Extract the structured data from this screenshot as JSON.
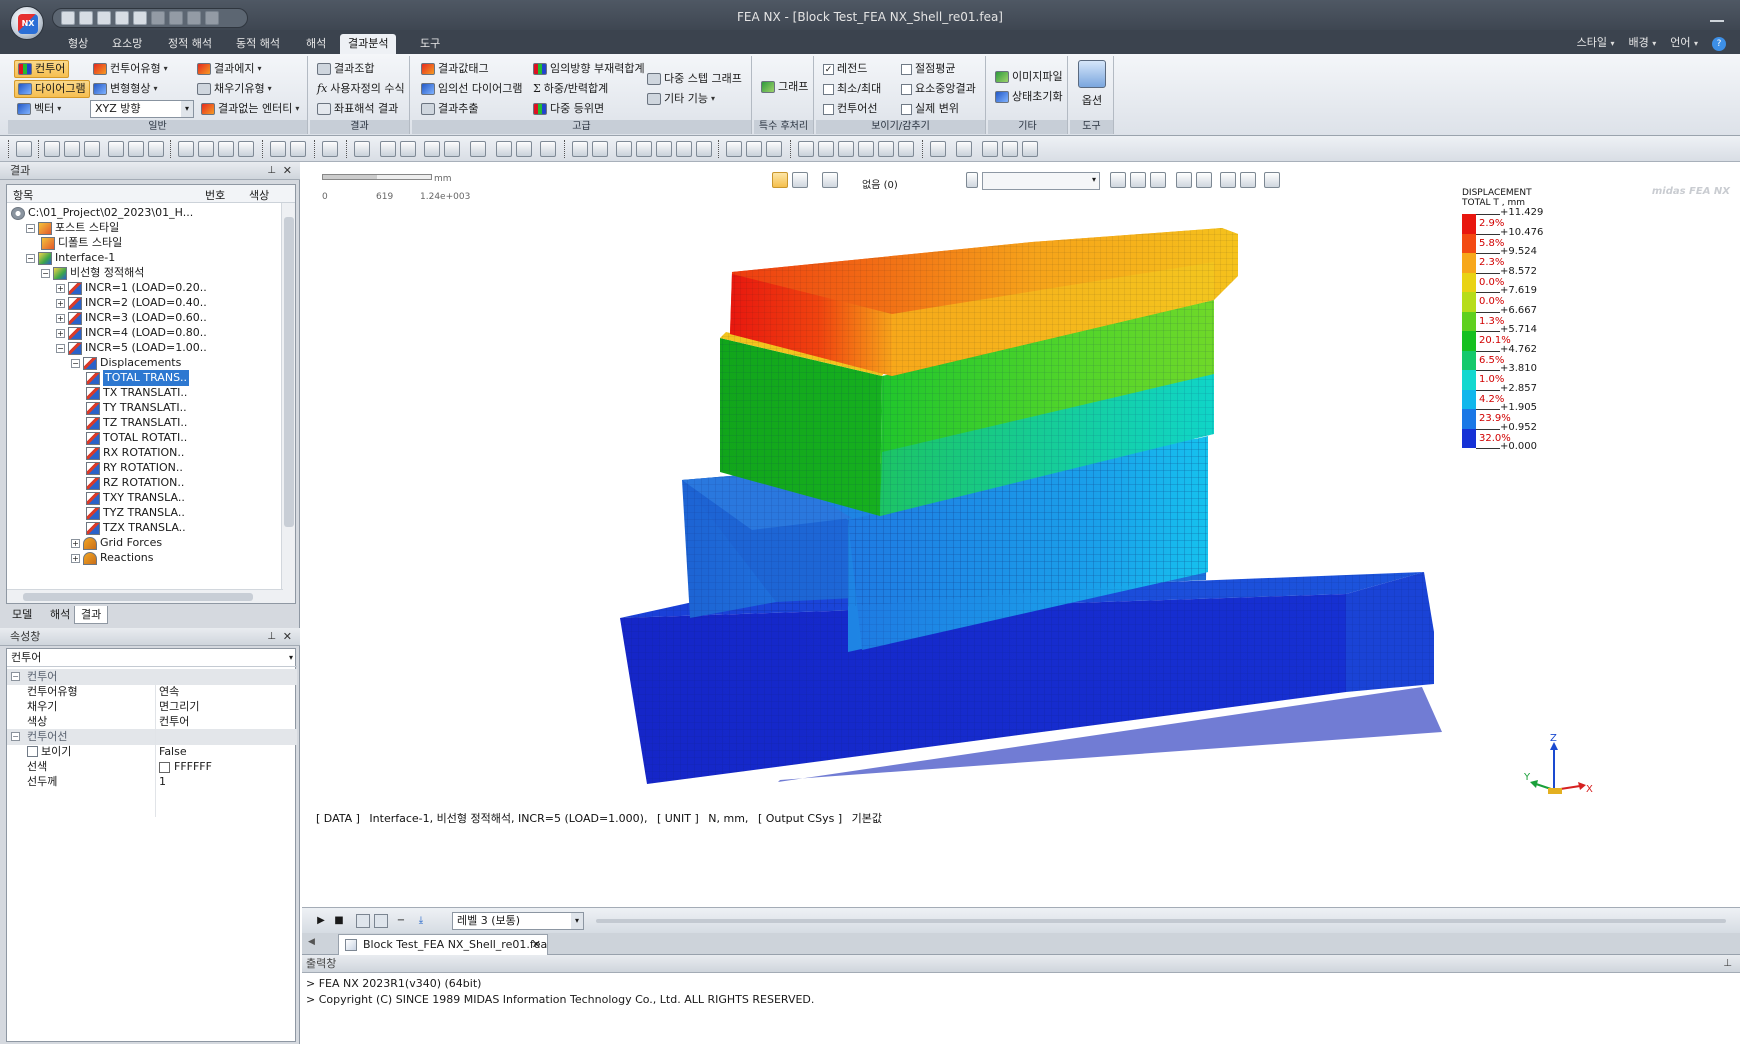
{
  "window": {
    "title": "FEA NX - [Block Test_FEA NX_Shell_re01.fea]",
    "logo_text": "NX"
  },
  "ribbon_tabs": [
    "형상",
    "요소망",
    "정적 해석",
    "동적 해석",
    "해석",
    "결과분석",
    "도구"
  ],
  "active_tab": "결과분석",
  "ribbon_right": {
    "style": "스타일",
    "background": "배경",
    "language": "언어",
    "help": "?"
  },
  "ribbon": {
    "general": {
      "label": "일반",
      "contour": "컨투어",
      "contour_type": "컨투어유형",
      "result_edge": "결과에지",
      "diagram": "다이어그램",
      "deformed": "변형형상",
      "fill_type": "채우기유형",
      "vector": "벡터",
      "xyz_direction": "XYZ 방향",
      "no_result_entity": "결과없는 엔터티"
    },
    "result": {
      "label": "결과",
      "combination": "결과조합",
      "user_formula": "사용자정의 수식",
      "coord_result": "좌표해석 결과"
    },
    "advanced": {
      "label": "고급",
      "result_tag": "결과값태그",
      "arbitrary_line_diagram": "임의선 다이어그램",
      "result_extract": "결과추출",
      "arbitrary_member_force": "임의방향 부재력합계",
      "load_reaction_sum": "하중/반력합계",
      "multi_iso_surface": "다중 등위면",
      "multi_step_graph": "다중 스텝 그래프",
      "other_functions": "기타 기능"
    },
    "special_post": {
      "label": "특수 후처리",
      "graph": "그래프"
    },
    "show_hide": {
      "label": "보이기/감추기",
      "legend": "레전드",
      "min_max": "최소/최대",
      "contour_line": "컨투어선",
      "node_average": "절점평균",
      "element_result": "요소중앙결과",
      "real_displacement": "실제 변위"
    },
    "etc": {
      "label": "기타",
      "image_file": "이미지파일",
      "state_reset": "상태초기화"
    },
    "tools": {
      "label": "도구",
      "options": "옵션"
    }
  },
  "left_panel": {
    "result_title": "결과",
    "headers": {
      "item": "항목",
      "number": "번호",
      "color": "색상"
    },
    "tree": [
      {
        "label": "C:\\01_Project\\02_2023\\01_H...",
        "level": 0,
        "icon": "path-icon",
        "toggle": ""
      },
      {
        "label": "포스트 스타일",
        "level": 1,
        "icon": "post-style-icon",
        "toggle": "−"
      },
      {
        "label": "디폴트 스타일",
        "level": 2,
        "icon": "post-style-icon",
        "toggle": ""
      },
      {
        "label": "Interface-1",
        "level": 1,
        "icon": "analysis-case-icon",
        "toggle": "−"
      },
      {
        "label": "비선형 정적해석",
        "level": 2,
        "icon": "analysis-case-icon",
        "toggle": "−"
      },
      {
        "label": "INCR=1 (LOAD=0.20..",
        "level": 3,
        "icon": "result-chart-icon",
        "toggle": "+"
      },
      {
        "label": "INCR=2 (LOAD=0.40..",
        "level": 3,
        "icon": "result-chart-icon",
        "toggle": "+"
      },
      {
        "label": "INCR=3 (LOAD=0.60..",
        "level": 3,
        "icon": "result-chart-icon",
        "toggle": "+"
      },
      {
        "label": "INCR=4 (LOAD=0.80..",
        "level": 3,
        "icon": "result-chart-icon",
        "toggle": "+"
      },
      {
        "label": "INCR=5 (LOAD=1.00..",
        "level": 3,
        "icon": "result-chart-icon",
        "toggle": "−"
      },
      {
        "label": "Displacements",
        "level": 4,
        "icon": "result-group-icon",
        "toggle": "−"
      },
      {
        "label": "TOTAL TRANS..",
        "level": 5,
        "icon": "result-chart-icon",
        "toggle": "",
        "selected": true
      },
      {
        "label": "TX TRANSLATI..",
        "level": 5,
        "icon": "result-chart-icon",
        "toggle": ""
      },
      {
        "label": "TY TRANSLATI..",
        "level": 5,
        "icon": "result-chart-icon",
        "toggle": ""
      },
      {
        "label": "TZ TRANSLATI..",
        "level": 5,
        "icon": "result-chart-icon",
        "toggle": ""
      },
      {
        "label": "TOTAL ROTATI..",
        "level": 5,
        "icon": "result-chart-icon",
        "toggle": ""
      },
      {
        "label": "RX ROTATION..",
        "level": 5,
        "icon": "result-chart-icon",
        "toggle": ""
      },
      {
        "label": "RY ROTATION..",
        "level": 5,
        "icon": "result-chart-icon",
        "toggle": ""
      },
      {
        "label": "RZ ROTATION..",
        "level": 5,
        "icon": "result-chart-icon",
        "toggle": ""
      },
      {
        "label": "TXY TRANSLA..",
        "level": 5,
        "icon": "result-chart-icon",
        "toggle": ""
      },
      {
        "label": "TYZ TRANSLA..",
        "level": 5,
        "icon": "result-chart-icon",
        "toggle": ""
      },
      {
        "label": "TZX TRANSLA..",
        "level": 5,
        "icon": "result-chart-icon",
        "toggle": ""
      },
      {
        "label": "Grid Forces",
        "level": 4,
        "icon": "force-group-icon",
        "toggle": "+"
      },
      {
        "label": "Reactions",
        "level": 4,
        "icon": "force-group-icon",
        "toggle": "+"
      }
    ],
    "tabs": [
      "모델",
      "해석",
      "결과"
    ],
    "active_panel_tab": "결과",
    "properties_title": "속성창",
    "properties_combo": "컨투어",
    "properties": [
      {
        "kind": "cat",
        "key": "컨투어"
      },
      {
        "kind": "row",
        "key": "컨투어유형",
        "value": "연속"
      },
      {
        "kind": "row",
        "key": "채우기",
        "value": "면그리기"
      },
      {
        "kind": "row",
        "key": "색상",
        "value": "컨투어"
      },
      {
        "kind": "cat",
        "key": "컨투어선"
      },
      {
        "kind": "row",
        "key": "보이기",
        "value": "False",
        "checkbox": true
      },
      {
        "kind": "row",
        "key": "선색",
        "value": "FFFFFF",
        "swatch": "#FFFFFF"
      },
      {
        "kind": "row",
        "key": "선두께",
        "value": "1"
      }
    ]
  },
  "viewport": {
    "scale": {
      "unit": "mm",
      "t0": "0",
      "t1": "619",
      "t2": "1.24e+003"
    },
    "view_select": "없음 (0)",
    "brand": "midas FEA NX",
    "legend": {
      "title": "DISPLACEMENT",
      "subtitle": "TOTAL T , mm",
      "values": [
        "+11.429",
        "+10.476",
        "+9.524",
        "+8.572",
        "+7.619",
        "+6.667",
        "+5.714",
        "+4.762",
        "+3.810",
        "+2.857",
        "+1.905",
        "+0.952",
        "+0.000"
      ],
      "percents": [
        "2.9%",
        "5.8%",
        "2.3%",
        "0.0%",
        "0.0%",
        "1.3%",
        "20.1%",
        "6.5%",
        "1.0%",
        "4.2%",
        "23.9%",
        "32.0%"
      ],
      "colors": [
        "#e8170f",
        "#f34a12",
        "#f7a71a",
        "#e9d313",
        "#b6dd1a",
        "#5fd01f",
        "#15c020",
        "#14c96c",
        "#12d8cf",
        "#11b7ec",
        "#1a78e6",
        "#1632d6"
      ]
    },
    "axis": {
      "x": "X",
      "y": "Y",
      "z": "Z"
    },
    "status": {
      "data_tag": "[ DATA ]",
      "data_value": "Interface-1, 비선형 정적해석, INCR=5 (LOAD=1.000),",
      "unit_tag": "[ UNIT ]",
      "unit_value": "N, mm,",
      "csys_tag": "[ Output CSys ]",
      "csys_value": "기본값"
    }
  },
  "animation": {
    "level": "레벨 3 (보통)"
  },
  "document_tab": "Block Test_FEA NX_Shell_re01.fea",
  "output": {
    "title": "출력창",
    "lines": [
      "> FEA NX 2023R1(v340) (64bit)",
      "> Copyright (C) SINCE 1989 MIDAS Information Technology Co., Ltd. ALL RIGHTS RESERVED."
    ]
  }
}
